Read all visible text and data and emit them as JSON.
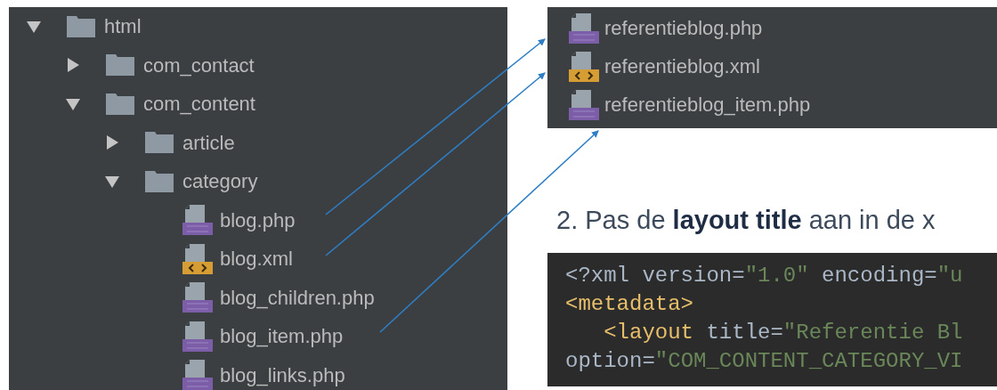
{
  "file_tree": [
    {
      "name": "html",
      "kind": "folder",
      "expanded": true,
      "children": [
        {
          "name": "com_contact",
          "kind": "folder",
          "expanded": false
        },
        {
          "name": "com_content",
          "kind": "folder",
          "expanded": true,
          "children": [
            {
              "name": "article",
              "kind": "folder",
              "expanded": false
            },
            {
              "name": "category",
              "kind": "folder",
              "expanded": true,
              "children": [
                {
                  "name": "blog.php",
                  "kind": "php"
                },
                {
                  "name": "blog.xml",
                  "kind": "xml"
                },
                {
                  "name": "blog_children.php",
                  "kind": "php"
                },
                {
                  "name": "blog_item.php",
                  "kind": "php"
                },
                {
                  "name": "blog_links.php",
                  "kind": "php"
                }
              ]
            }
          ]
        }
      ]
    }
  ],
  "new_files": [
    {
      "name": "referentieblog.php",
      "kind": "php"
    },
    {
      "name": "referentieblog.xml",
      "kind": "xml"
    },
    {
      "name": "referentieblog_item.php",
      "kind": "php"
    }
  ],
  "step_heading": "2. Pas de **layout title** aan in de x",
  "code_lines": [
    [
      {
        "kind": "plain",
        "text": "<?xml version="
      },
      {
        "kind": "value",
        "text": "\"1.0\""
      },
      {
        "kind": "plain",
        "text": " encoding="
      },
      {
        "kind": "value",
        "text": "\"u"
      }
    ],
    [
      {
        "kind": "tag",
        "text": "<metadata>"
      }
    ],
    [
      {
        "kind": "tag",
        "text": "   <layout"
      },
      {
        "kind": "plain",
        "text": " title="
      },
      {
        "kind": "value",
        "text": "\"Referentie Bl"
      }
    ],
    [
      {
        "kind": "plain",
        "text": "option="
      },
      {
        "kind": "value",
        "text": "\"COM_CONTENT_CATEGORY_VI"
      }
    ]
  ]
}
